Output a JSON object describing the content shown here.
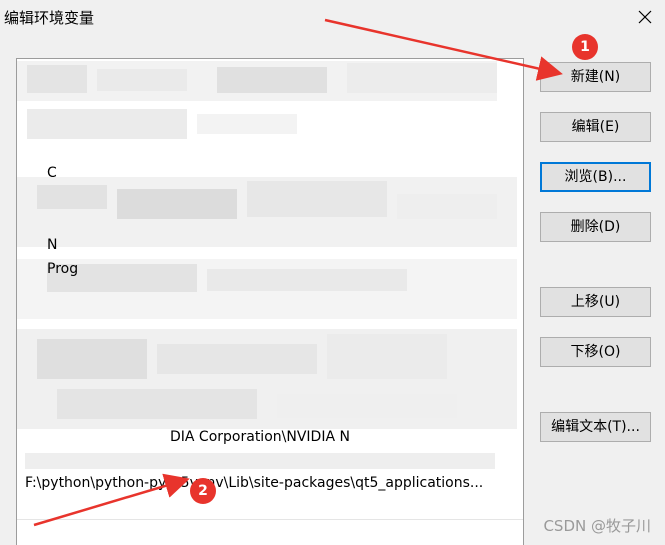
{
  "window": {
    "title": "编辑环境变量"
  },
  "list": {
    "visible_fragments": [
      "DIA Corporation\\NVIDIA N",
      "F:\\python\\python-pyqt5venv\\Lib\\site-packages\\qt5_applications..."
    ],
    "selected_row_text": "F:\\python\\python-pyqt5venv\\Lib\\site-packages\\qt5_applications..."
  },
  "buttons": {
    "new": "新建(N)",
    "edit": "编辑(E)",
    "browse": "浏览(B)...",
    "delete": "删除(D)",
    "move_up": "上移(U)",
    "move_down": "下移(O)",
    "edit_text": "编辑文本(T)..."
  },
  "annotations": {
    "badge1": "1",
    "badge2": "2"
  },
  "watermark": "CSDN @牧子川",
  "colors": {
    "accent": "#0078d7",
    "annotation": "#e8342c"
  }
}
